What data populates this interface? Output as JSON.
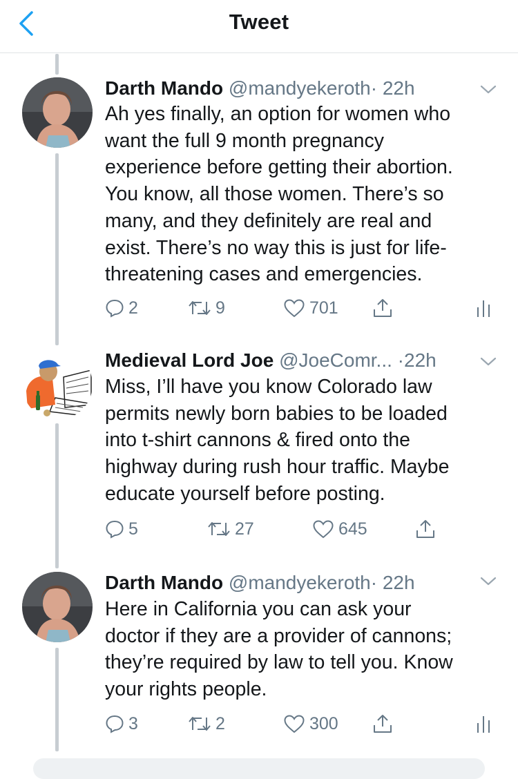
{
  "header": {
    "title": "Tweet"
  },
  "tweets": [
    {
      "name": "Darth Mando",
      "handle": "@mandyekeroth",
      "dot": "·",
      "time": "22h",
      "text": "Ah yes finally, an option for women who\nwant the full 9 month pregnancy\nexperience before getting their abortion.\nYou know, all those women. There’s so\nmany, and they definitely are real and\nexist. There’s no way this is just for life-\nthreatening cases and emergencies.",
      "replies": "2",
      "retweets": "9",
      "likes": "701"
    },
    {
      "name": "Medieval Lord Joe",
      "handle": "@JoeComr...",
      "dot": "·",
      "time": "22h",
      "text": "Miss, I’ll have you know Colorado law\npermits newly born babies to be loaded\ninto t-shirt cannons & fired onto the\nhighway during rush hour traffic. Maybe\neducate yourself before posting.",
      "replies": "5",
      "retweets": "27",
      "likes": "645"
    },
    {
      "name": "Darth Mando",
      "handle": "@mandyekeroth",
      "dot": "·",
      "time": "22h",
      "text": "Here in California you can ask your\ndoctor if they are a provider of cannons;\nthey’re required by law to tell you. Know\nyour rights people.",
      "replies": "3",
      "retweets": "2",
      "likes": "300"
    }
  ],
  "colors": {
    "accent": "#1da1f2",
    "muted": "#657786",
    "text": "#14171a",
    "thread_line": "#c7cdd2"
  },
  "icons": [
    "back-chevron-icon",
    "caret-down-icon",
    "reply-icon",
    "retweet-icon",
    "like-icon",
    "share-icon",
    "analytics-icon"
  ]
}
